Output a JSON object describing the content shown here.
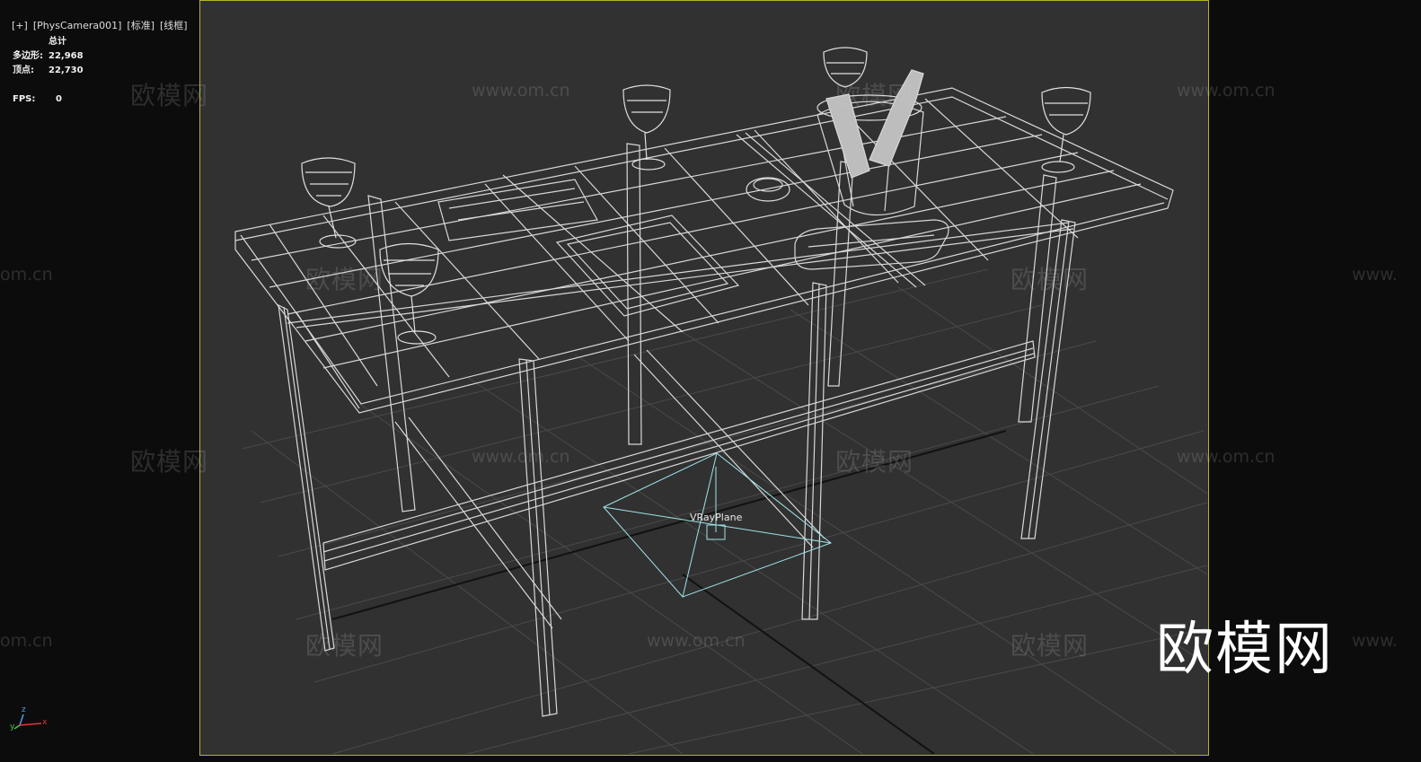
{
  "viewport": {
    "label_plus": "[+]",
    "label_camera": "[PhysCamera001]",
    "label_shading": "[标准]",
    "label_mode": "[线框]"
  },
  "stats": {
    "header": "总计",
    "polygons_label": "多边形:",
    "polygons_value": "22,968",
    "vertices_label": "顶点:",
    "vertices_value": "22,730",
    "fps_label": "FPS:",
    "fps_value": "0"
  },
  "scene": {
    "object_label": "VRayPlane",
    "wireframe_color": "#d8d8d8",
    "light_color": "#9fe3e8",
    "background_color": "#313131",
    "frame_color": "#b5b52c"
  },
  "gizmo": {
    "z": "z",
    "x": "x",
    "y": "y"
  },
  "watermarks": {
    "cn": "欧模网",
    "url": "www.om.cn",
    "url_partial_left": "om.cn",
    "url_partial_right": "www."
  },
  "logo": {
    "text": "欧模网"
  }
}
